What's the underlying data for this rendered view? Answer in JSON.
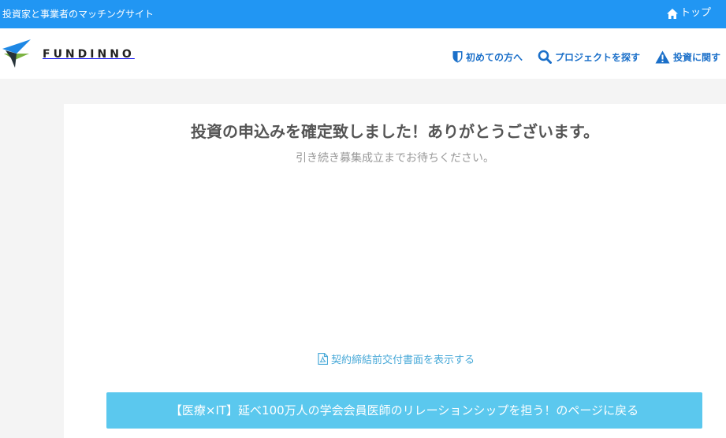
{
  "topbar": {
    "tagline": "投資家と事業者のマッチングサイト",
    "top_link": "トップ"
  },
  "header": {
    "logo_text": "FUNDINNO",
    "nav": [
      {
        "label": "初めての方へ",
        "icon": "shield-icon"
      },
      {
        "label": "プロジェクトを探す",
        "icon": "search-icon"
      },
      {
        "label": "投資に関す",
        "icon": "warning-icon"
      }
    ]
  },
  "main": {
    "title": "投資の申込みを確定致しました！ありがとうございます。",
    "subtitle": "引き続き募集成立までお待ちください。",
    "doc_link": "契約締結前交付書面を表示する",
    "back_button": "【医療×IT】延べ100万人の学会会員医師のリレーションシップを担う！のページに戻る"
  },
  "colors": {
    "topbar": "#2196f3",
    "nav_text": "#1a6fc9",
    "button": "#5bc8ee",
    "link": "#48a9d8"
  }
}
